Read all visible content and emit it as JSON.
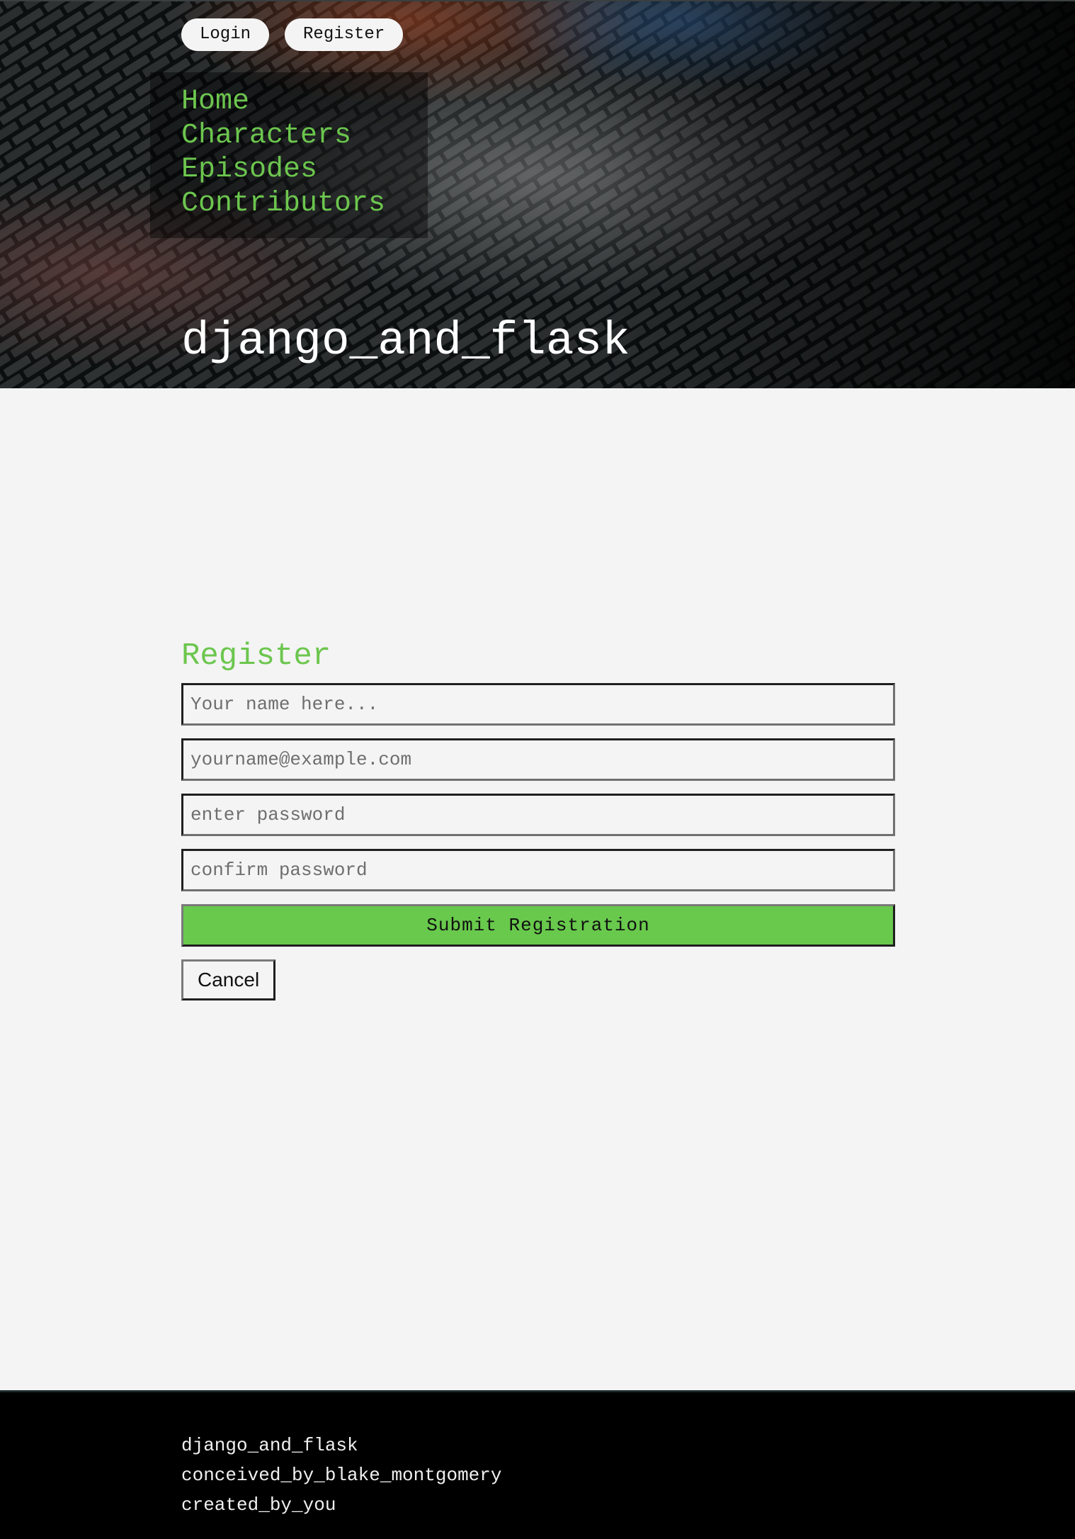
{
  "header": {
    "auth_buttons": {
      "login": "Login",
      "register": "Register"
    },
    "nav": [
      "Home",
      "Characters",
      "Episodes",
      "Contributors"
    ],
    "site_title": "django_and_flask"
  },
  "form": {
    "title": "Register",
    "name_placeholder": "Your name here...",
    "email_placeholder": "yourname@example.com",
    "password_placeholder": "enter password",
    "confirm_placeholder": "confirm password",
    "submit_label": "Submit Registration",
    "cancel_label": "Cancel"
  },
  "footer": {
    "lines": [
      "django_and_flask",
      "conceived_by_blake_montgomery",
      "created_by_you"
    ]
  },
  "colors": {
    "accent_green": "#6cc64e",
    "submit_green": "#68c94c",
    "page_bg": "#f4f4f4",
    "header_bg": "#06090a",
    "footer_bg": "#000000"
  },
  "icons": {
    "header_background": "brick-pavement-photo"
  }
}
